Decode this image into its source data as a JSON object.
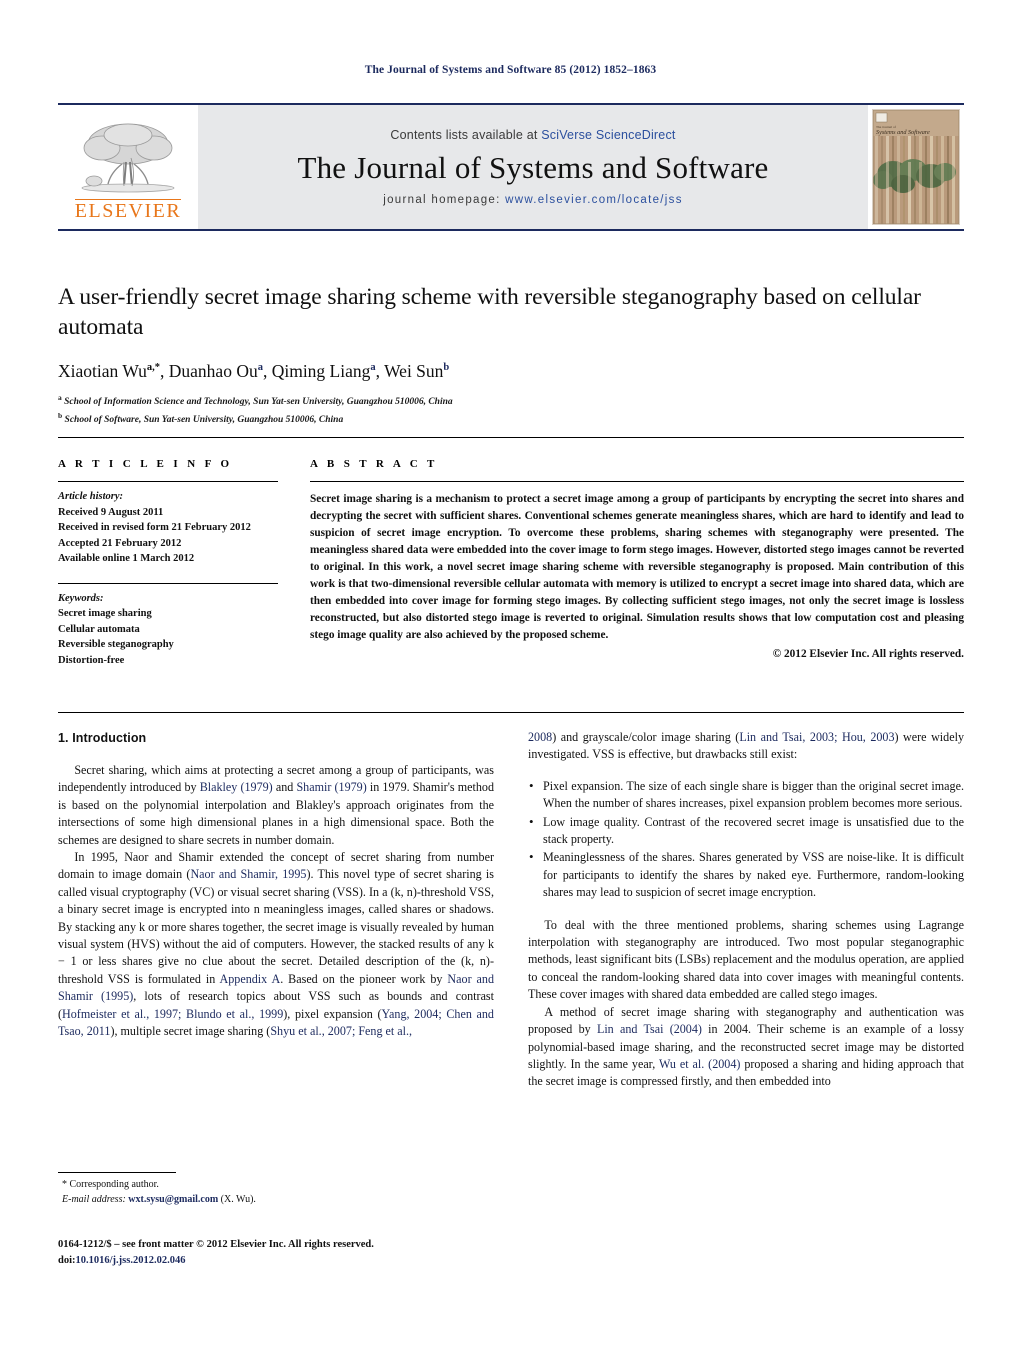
{
  "running_head": "The Journal of Systems and Software 85 (2012) 1852–1863",
  "masthead": {
    "contents_prefix": "Contents lists available at ",
    "contents_link": "SciVerse ScienceDirect",
    "journal_title": "The Journal of Systems and Software",
    "homepage_label": "journal homepage:",
    "homepage_url": "www.elsevier.com/locate/jss",
    "publisher_name": "ELSEVIER",
    "cover_title_small": "The Journal of",
    "cover_title_main": "Systems and Software"
  },
  "article": {
    "title": "A user-friendly secret image sharing scheme with reversible steganography based on cellular automata",
    "authors": [
      {
        "name": "Xiaotian Wu",
        "sup": "a,*"
      },
      {
        "name": "Duanhao Ou",
        "sup": "a"
      },
      {
        "name": "Qiming Liang",
        "sup": "a"
      },
      {
        "name": "Wei Sun",
        "sup": "b"
      }
    ],
    "affiliations": [
      {
        "mark": "a",
        "text": "School of Information Science and Technology, Sun Yat-sen University, Guangzhou 510006, China"
      },
      {
        "mark": "b",
        "text": "School of Software, Sun Yat-sen University, Guangzhou 510006, China"
      }
    ]
  },
  "info": {
    "heading": "A R T I C L E  I N F O",
    "history_title": "Article history:",
    "history": [
      "Received 9 August 2011",
      "Received in revised form 21 February 2012",
      "Accepted 21 February 2012",
      "Available online 1 March 2012"
    ],
    "keywords_title": "Keywords:",
    "keywords": [
      "Secret image sharing",
      "Cellular automata",
      "Reversible steganography",
      "Distortion-free"
    ]
  },
  "abstract": {
    "heading": "A B S T R A C T",
    "text": "Secret image sharing is a mechanism to protect a secret image among a group of participants by encrypting the secret into shares and decrypting the secret with sufficient shares. Conventional schemes generate meaningless shares, which are hard to identify and lead to suspicion of secret image encryption. To overcome these problems, sharing schemes with steganography were presented. The meaningless shared data were embedded into the cover image to form stego images. However, distorted stego images cannot be reverted to original. In this work, a novel secret image sharing scheme with reversible steganography is proposed. Main contribution of this work is that two-dimensional reversible cellular automata with memory is utilized to encrypt a secret image into shared data, which are then embedded into cover image for forming stego images. By collecting sufficient stego images, not only the secret image is lossless reconstructed, but also distorted stego image is reverted to original. Simulation results shows that low computation cost and pleasing stego image quality are also achieved by the proposed scheme.",
    "copyright": "© 2012 Elsevier Inc. All rights reserved."
  },
  "body": {
    "section_heading": "1.  Introduction",
    "left_p1": "Secret sharing, which aims at protecting a secret among a group of participants, was independently introduced by ",
    "left_p1_ref1": "Blakley (1979)",
    "left_p1_mid": " and ",
    "left_p1_ref2": "Shamir (1979)",
    "left_p1_end": " in 1979. Shamir's method is based on the polynomial interpolation and Blakley's approach originates from the intersections of some high dimensional planes in a high dimensional space. Both the schemes are designed to share secrets in number domain.",
    "left_p2_a": "In 1995, Naor and Shamir extended the concept of secret sharing from number domain to image domain (",
    "left_p2_ref1": "Naor and Shamir, 1995",
    "left_p2_b": "). This novel type of secret sharing is called visual cryptography (VC) or visual secret sharing (VSS). In a (k, n)-threshold VSS, a binary secret image is encrypted into n meaningless images, called shares or shadows. By stacking any k or more shares together, the secret image is visually revealed by human visual system (HVS) without the aid of computers. However, the stacked results of any k − 1 or less shares give no clue about the secret. Detailed description of the (k, n)-threshold VSS is formulated in ",
    "left_p2_ref2": "Appendix A",
    "left_p2_c": ". Based on the pioneer work by ",
    "left_p2_ref3": "Naor and Shamir (1995)",
    "left_p2_d": ", lots of research topics about VSS such as bounds and contrast (",
    "left_p2_ref4": "Hofmeister et al., 1997; Blundo et al., 1999",
    "left_p2_e": "), pixel expansion (",
    "left_p2_ref5": "Yang, 2004; Chen and Tsao, 2011",
    "left_p2_f": "), multiple secret image sharing (",
    "left_p2_ref6": "Shyu et al., 2007; Feng et al.,",
    "right_p1_ref0": "2008",
    "right_p1_a": ") and grayscale/color image sharing (",
    "right_p1_ref1": "Lin and Tsai, 2003; Hou, 2003",
    "right_p1_b": ") were widely investigated. VSS is effective, but drawbacks still exist:",
    "bullets": [
      "Pixel expansion. The size of each single share is bigger than the original secret image. When the number of shares increases, pixel expansion problem becomes more serious.",
      "Low image quality. Contrast of the recovered secret image is unsatisfied due to the stack property.",
      "Meaninglessness of the shares. Shares generated by VSS are noise-like. It is difficult for participants to identify the shares by naked eye. Furthermore, random-looking shares may lead to suspicion of secret image encryption."
    ],
    "right_p2": "To deal with the three mentioned problems, sharing schemes using Lagrange interpolation with steganography are introduced. Two most popular steganographic methods, least significant bits (LSBs) replacement and the modulus operation, are applied to conceal the random-looking shared data into cover images with meaningful contents. These cover images with shared data embedded are called stego images.",
    "right_p3_a": "A method of secret image sharing with steganography and authentication was proposed by ",
    "right_p3_ref1": "Lin and Tsai (2004)",
    "right_p3_b": " in 2004. Their scheme is an example of a lossy polynomial-based image sharing, and the reconstructed secret image may be distorted slightly. In the same year, ",
    "right_p3_ref2": "Wu et al. (2004)",
    "right_p3_c": " proposed a sharing and hiding approach that the secret image is compressed firstly, and then embedded into"
  },
  "footnote": {
    "corresponding": "* Corresponding author.",
    "email_label": "E-mail address:",
    "email": "wxt.sysu@gmail.com",
    "email_suffix": "(X. Wu)."
  },
  "imprint": {
    "line1": "0164-1212/$ – see front matter © 2012 Elsevier Inc. All rights reserved.",
    "doi_label": "doi:",
    "doi_value": "10.1016/j.jss.2012.02.046"
  },
  "colors": {
    "link": "#1c2a5e",
    "elsevier_orange": "#e8761a",
    "masthead_bg": "#e7e8ea",
    "rule": "#1c2a5e"
  }
}
